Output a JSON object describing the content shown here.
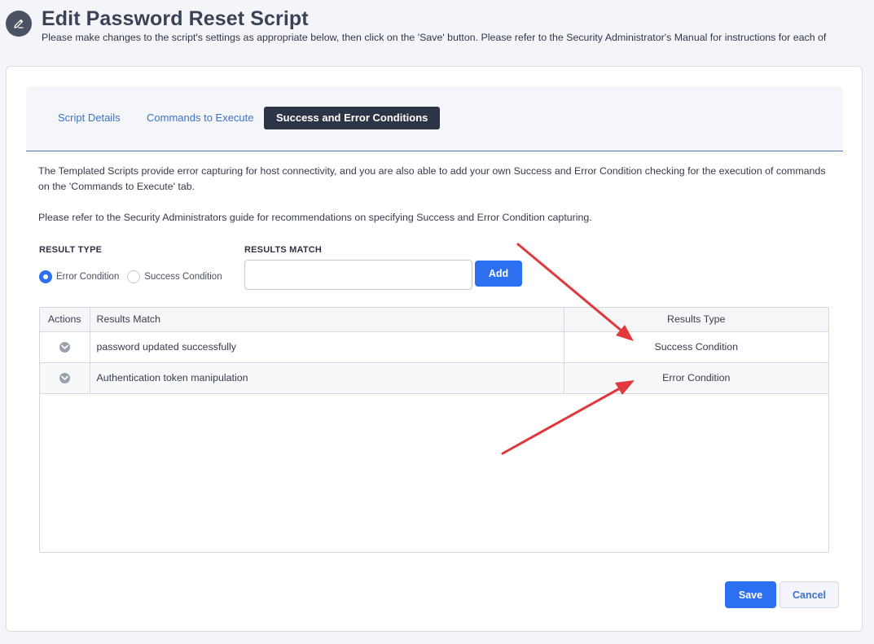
{
  "header": {
    "title": "Edit Password Reset Script",
    "subtitle": "Please make changes to the script's settings as appropriate below, then click on the 'Save' button. Please refer to the Security Administrator's Manual for instructions for each of"
  },
  "tabs": [
    {
      "label": "Script Details",
      "active": false
    },
    {
      "label": "Commands to Execute",
      "active": false
    },
    {
      "label": "Success and Error Conditions",
      "active": true
    }
  ],
  "description": {
    "para1": "The Templated Scripts provide error capturing for host connectivity, and you are also able to add your own Success and Error Condition checking for the execution of commands on the 'Commands to Execute' tab.",
    "para2": "Please refer to the Security Administrators guide for recommendations on specifying Success and Error Condition capturing."
  },
  "form": {
    "result_type_label": "RESULT TYPE",
    "results_match_label": "RESULTS MATCH",
    "radio_error": "Error Condition",
    "radio_success": "Success Condition",
    "selected": "Error Condition",
    "results_match_value": "",
    "add_label": "Add"
  },
  "table": {
    "headers": {
      "actions": "Actions",
      "match": "Results Match",
      "type": "Results Type"
    },
    "rows": [
      {
        "match": "password updated successfully",
        "type": "Success Condition"
      },
      {
        "match": "Authentication token manipulation",
        "type": "Error Condition"
      }
    ]
  },
  "footer": {
    "save_label": "Save",
    "cancel_label": "Cancel"
  },
  "icons": {
    "header": "pencil-icon",
    "row_action": "chevron-down-icon",
    "annotation": "red-arrow"
  },
  "colors": {
    "primary": "#2c6ff0",
    "active_tab": "#2d3446",
    "link": "#3c72c9",
    "annotation": "#e0383c"
  }
}
